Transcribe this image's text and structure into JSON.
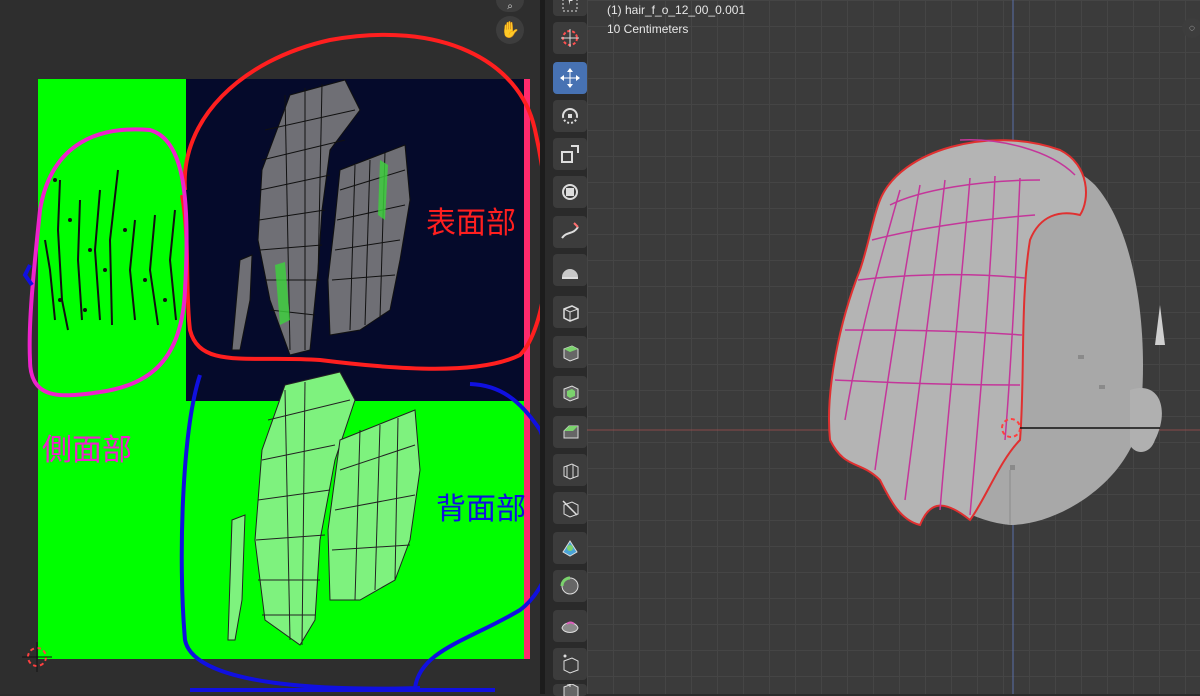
{
  "viewport": {
    "object_name": "(1) hair_f_o_12_00_0.001",
    "scale_label": "10 Centimeters"
  },
  "annotations": {
    "front": "表面部",
    "side": "側面部",
    "back": "背面部"
  },
  "colors": {
    "front_marker": "#ff1f1f",
    "side_marker": "#ee22cc",
    "back_marker": "#1010e0",
    "uv_green": "#00ff00",
    "uv_dark": "#050a2b",
    "active_tool": "#4772b3"
  },
  "toolbar": {
    "tools": [
      {
        "icon": "select-box-icon"
      },
      {
        "icon": "cursor-icon"
      },
      {
        "icon": "move-icon",
        "active": true
      },
      {
        "icon": "rotate-icon"
      },
      {
        "icon": "scale-icon"
      },
      {
        "icon": "transform-icon"
      },
      {
        "icon": "annotate-icon"
      },
      {
        "icon": "measure-icon"
      },
      {
        "icon": "add-cube-icon"
      },
      {
        "icon": "extrude-region-icon"
      },
      {
        "icon": "inset-faces-icon"
      },
      {
        "icon": "bevel-icon"
      },
      {
        "icon": "loop-cut-icon"
      },
      {
        "icon": "knife-icon"
      },
      {
        "icon": "poly-build-icon"
      },
      {
        "icon": "spin-icon"
      },
      {
        "icon": "smooth-icon"
      },
      {
        "icon": "edge-slide-icon"
      },
      {
        "icon": "shrink-fatten-icon"
      }
    ]
  }
}
